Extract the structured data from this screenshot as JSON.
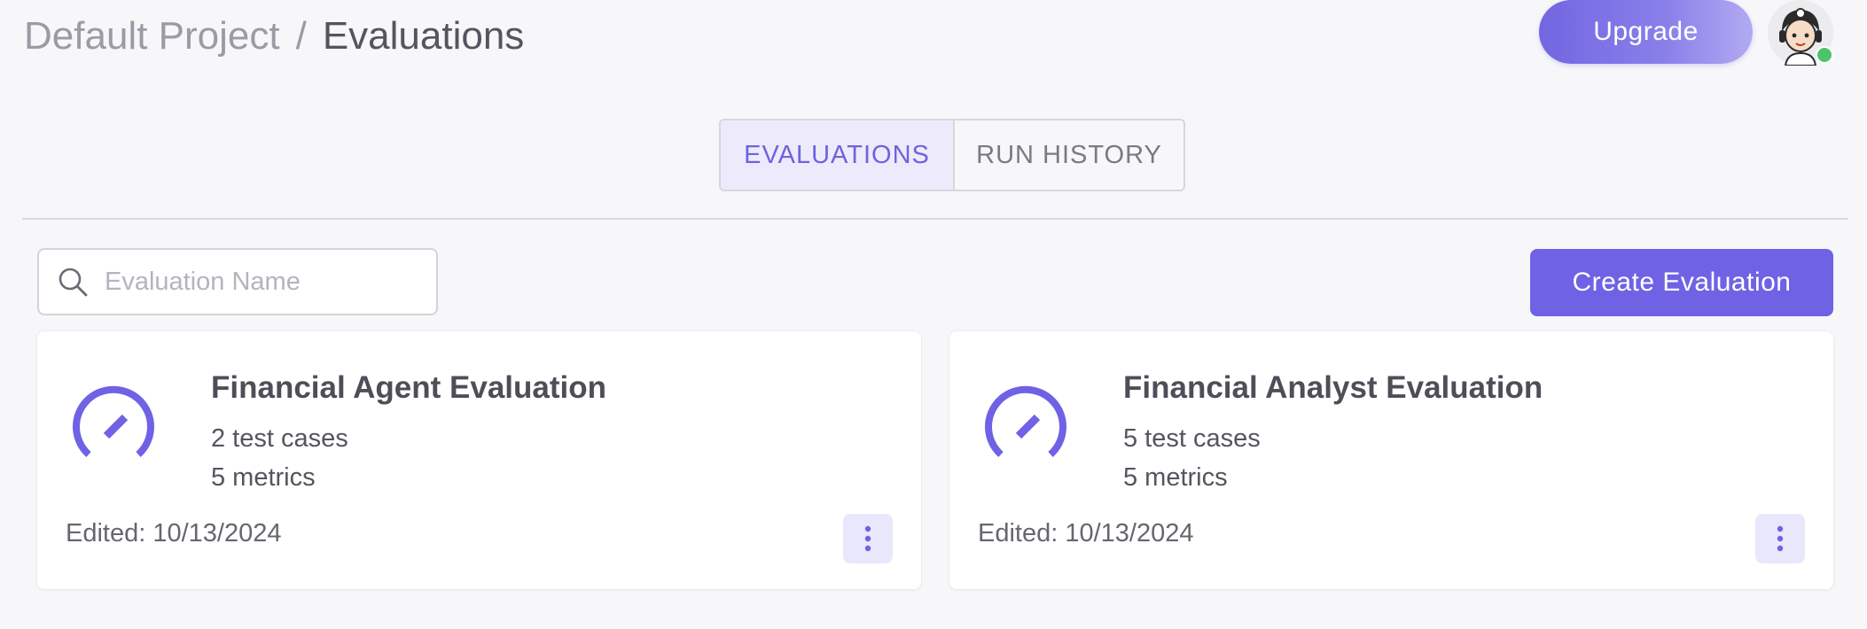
{
  "header": {
    "breadcrumb": {
      "project": "Default Project",
      "separator": "/",
      "current": "Evaluations"
    },
    "upgrade_label": "Upgrade",
    "avatar_status_color": "#4cc46a"
  },
  "tabs": [
    {
      "label": "EVALUATIONS",
      "active": true
    },
    {
      "label": "RUN HISTORY",
      "active": false
    }
  ],
  "search": {
    "placeholder": "Evaluation Name",
    "value": ""
  },
  "create_label": "Create Evaluation",
  "evaluations": [
    {
      "title": "Financial Agent Evaluation",
      "test_cases": "2 test cases",
      "metrics": "5 metrics",
      "edited": "Edited: 10/13/2024",
      "icon": "speedometer-icon"
    },
    {
      "title": "Financial Analyst Evaluation",
      "test_cases": "5 test cases",
      "metrics": "5 metrics",
      "edited": "Edited: 10/13/2024",
      "icon": "speedometer-icon"
    }
  ],
  "colors": {
    "accent": "#6f62e4",
    "background": "#f7f7fa",
    "tab_active_bg": "#edebfb"
  }
}
